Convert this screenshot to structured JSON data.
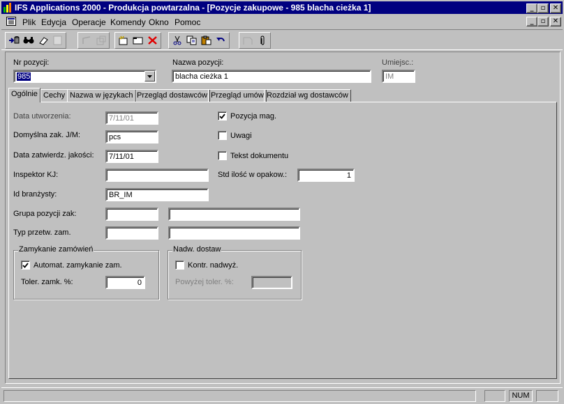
{
  "window": {
    "title": "IFS Applications 2000 - Produkcja powtarzalna - [Pozycje zakupowe - 985 blacha cieżka 1]",
    "title_color": "#000080",
    "buttons": [
      "_",
      "▫",
      "✕"
    ]
  },
  "menu": {
    "items": [
      "Plik",
      "Edycja",
      "Operacje",
      "Komendy",
      "Okno",
      "Pomoc"
    ],
    "mdi_buttons": [
      "_",
      "▫",
      "✕"
    ]
  },
  "toolbar": {
    "icons": [
      "populate-icon",
      "search-icon",
      "eraser-icon",
      "blank-icon",
      "undo-disabled-icon",
      "duplicate-icon",
      "new-icon",
      "open-folder-icon",
      "delete-icon",
      "cut-icon",
      "copy-icon",
      "paste-icon",
      "undo-icon",
      "document-icon",
      "attachment-icon"
    ]
  },
  "header": {
    "part_no_label": "Nr pozycji:",
    "part_no_value": "985",
    "description_label": "Nazwa pozycji:",
    "description_value": "blacha cieżka 1",
    "location_label": "Umiejsc.:",
    "location_value": "IM"
  },
  "tabs": [
    {
      "label": "Ogólnie",
      "active": true
    },
    {
      "label": "Cechy",
      "active": false
    },
    {
      "label": "Nazwa w językach",
      "active": false
    },
    {
      "label": "Przegląd dostawców",
      "active": false
    },
    {
      "label": "Przegląd umów",
      "active": false
    },
    {
      "label": "Rozdział wg dostawców",
      "active": false
    }
  ],
  "general": {
    "created_label": "Data utworzenia:",
    "created_value": "7/11/01",
    "default_uom_label": "Domyślna zak. J/M:",
    "default_uom_value": "pcs",
    "qc_date_label": "Data zatwierdz. jakości:",
    "qc_date_value": "7/11/01",
    "inspector_label": "Inspektor KJ:",
    "inspector_value": "",
    "buyer_label": "Id branżysty:",
    "buyer_value": "BR_IM",
    "part_group_label": "Grupa pozycji zak:",
    "part_group_value": "",
    "part_group_desc": "",
    "order_type_label": "Typ przetw. zam.",
    "order_type_value": "",
    "order_type_desc": "",
    "stock_part_label": "Pozycja mag.",
    "stock_part_checked": true,
    "notes_label": "Uwagi",
    "notes_checked": false,
    "doc_text_label": "Tekst dokumentu",
    "doc_text_checked": false,
    "std_pack_label": "Std ilość w opakow.:",
    "std_pack_value": "1"
  },
  "order_closing": {
    "title": "Zamykanie zamówień",
    "auto_close_label": "Automat. zamykanie zam.",
    "auto_close_checked": true,
    "tolerance_label": "Toler. zamk. %:",
    "tolerance_value": "0"
  },
  "over_delivery": {
    "title": "Nadw. dostaw",
    "control_label": "Kontr. nadwyż.",
    "control_checked": false,
    "above_tolerance_label": "Powyżej toler. %:",
    "above_tolerance_value": ""
  },
  "status": {
    "num": "NUM"
  }
}
